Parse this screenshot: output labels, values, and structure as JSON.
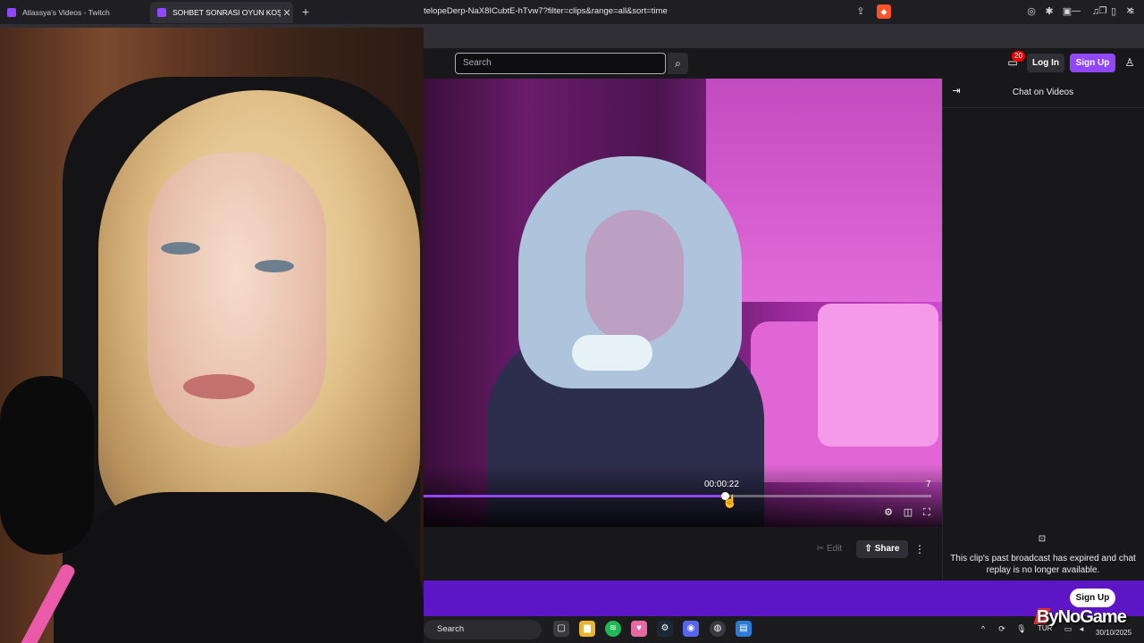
{
  "browser": {
    "tabs": [
      {
        "title": "Atlassya's Videos - Twitch"
      },
      {
        "title": "SOHBET SONRASI OYUN KOŞUN"
      }
    ],
    "url": "telopeDerp-NaX8ICubtE-hTvw7?filter=clips&range=all&sort=time"
  },
  "twitch": {
    "search_placeholder": "Search",
    "notification_count": "20",
    "login_label": "Log In",
    "signup_label": "Sign Up"
  },
  "player": {
    "timecode": "00:00:22",
    "end_label": "7",
    "progress": 0.594
  },
  "actions": {
    "edit_label": "Edit",
    "share_label": "Share"
  },
  "chat": {
    "title": "Chat on Videos",
    "message": "This clip's past broadcast has expired and chat replay is no longer available."
  },
  "banner": {
    "signup_label": "Sign Up"
  },
  "taskbar": {
    "search_label": "Search",
    "lang": "TUR",
    "date": "30/10/2025"
  },
  "watermark": "ByNoGame",
  "colors": {
    "twitch_purple": "#9147ff",
    "band_purple": "#5c16c5",
    "badge_red": "#eb0400"
  }
}
